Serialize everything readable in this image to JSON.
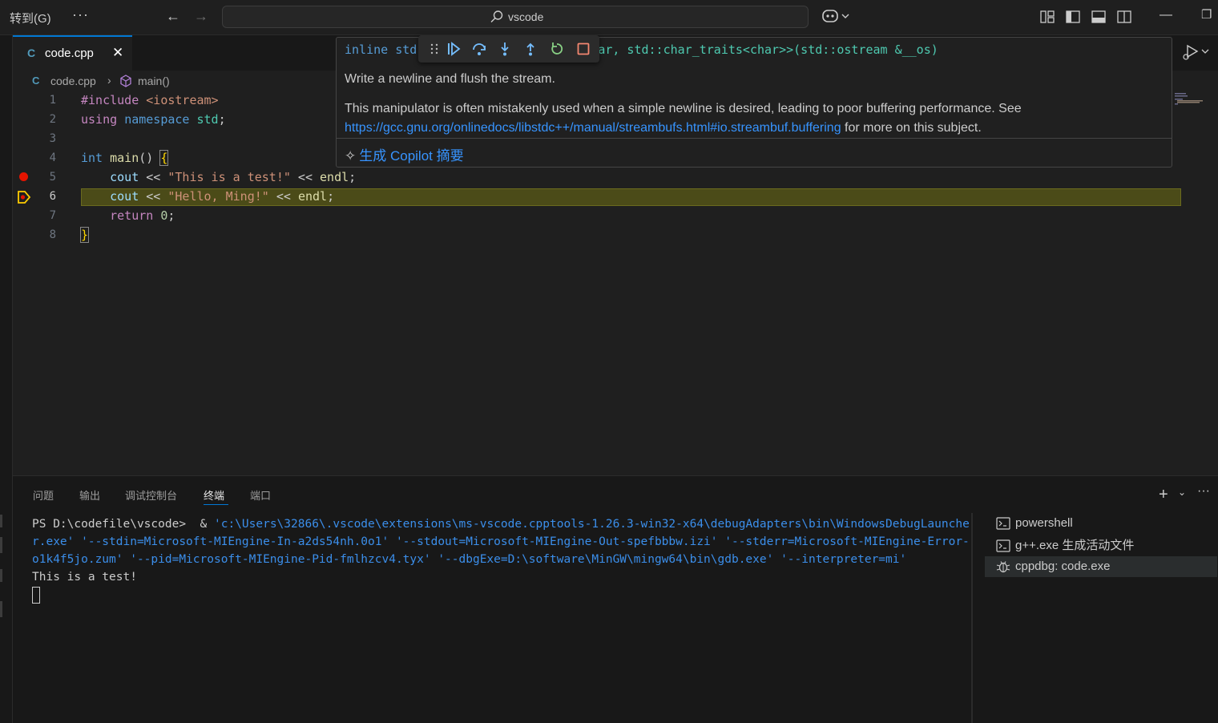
{
  "titlebar": {
    "menu_goto": "转到(G)",
    "menu_more": "···",
    "search_label": "vscode"
  },
  "editor": {
    "tab_label": "code.cpp",
    "tab_icon": "C",
    "breadcrumb": {
      "file": "code.cpp",
      "symbol": "main()"
    },
    "lines": [
      {
        "n": "1",
        "code": "#include <iostream>"
      },
      {
        "n": "2",
        "code": "using namespace std;"
      },
      {
        "n": "3",
        "code": ""
      },
      {
        "n": "4",
        "code": "int main() {"
      },
      {
        "n": "5",
        "code": "    cout << \"This is a test!\" << endl;"
      },
      {
        "n": "6",
        "code": "    cout << \"Hello, Ming!\" << endl;"
      },
      {
        "n": "7",
        "code": "    return 0;"
      },
      {
        "n": "8",
        "code": "}"
      }
    ],
    "breakpoint_line": "5",
    "current_line": "6"
  },
  "hover": {
    "signature_start": "inline std",
    "signature_end": "ar, std::char_traits<char>>(std::ostream &__os)",
    "line1": "Write a newline and flush the stream.",
    "line2": "This manipulator is often mistakenly used when a simple newline is desired, leading to poor buffering performance. See",
    "link": "https://gcc.gnu.org/onlinedocs/libstdc++/manual/streambufs.html#io.streambuf.buffering",
    "line2_tail": " for more on this subject.",
    "copilot": "生成 Copilot 摘要"
  },
  "panel": {
    "tabs": [
      "问题",
      "输出",
      "调试控制台",
      "终端",
      "端口"
    ],
    "active_tab": "终端",
    "terminal": {
      "prompt": "PS D:\\codefile\\vscode>  & ",
      "command": "'c:\\Users\\32866\\.vscode\\extensions\\ms-vscode.cpptools-1.26.3-win32-x64\\debugAdapters\\bin\\WindowsDebugLauncher.exe' '--stdin=Microsoft-MIEngine-In-a2ds54nh.0o1' '--stdout=Microsoft-MIEngine-Out-spefbbbw.izi' '--stderr=Microsoft-MIEngine-Error-o1k4f5jo.zum' '--pid=Microsoft-MIEngine-Pid-fmlhzcv4.tyx' '--dbgExe=D:\\software\\MinGW\\mingw64\\bin\\gdb.exe' '--interpreter=mi'",
      "output": "This is a test!"
    },
    "terminal_list": [
      {
        "label": "powershell",
        "icon": "terminal-icon"
      },
      {
        "label": "g++.exe 生成活动文件",
        "icon": "terminal-icon"
      },
      {
        "label": "cppdbg: code.exe",
        "icon": "debug-icon",
        "selected": true
      }
    ]
  },
  "colors": {
    "accent": "#0078d4",
    "breakpoint": "#e51400",
    "current_line_bg": "#4b4b18",
    "link": "#3794ff"
  }
}
